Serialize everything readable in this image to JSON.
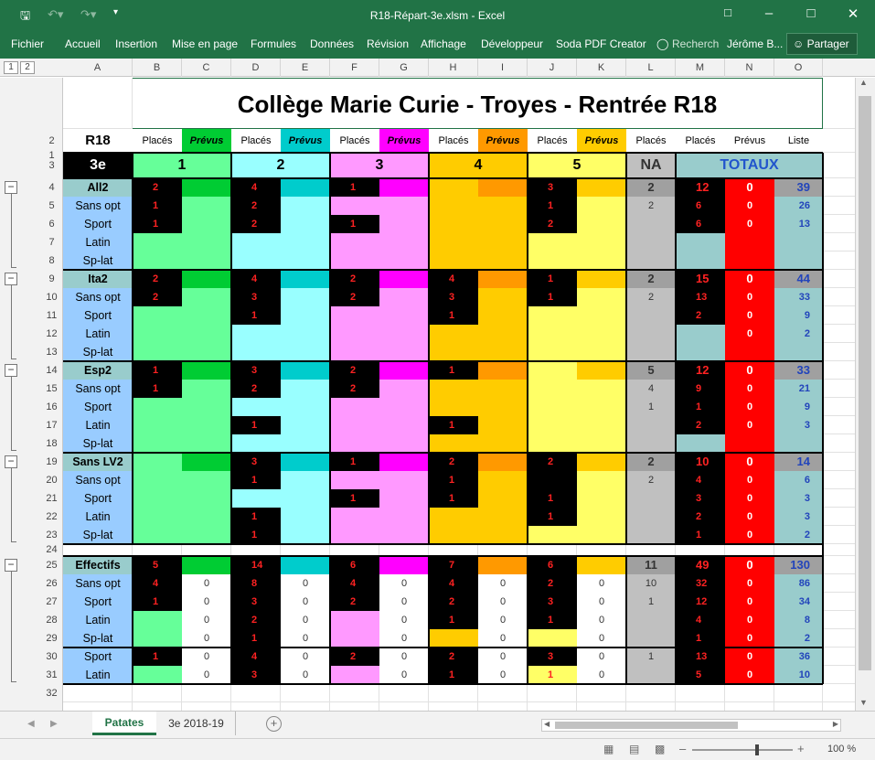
{
  "window": {
    "title": "R18-Répart-3e.xlsm - Excel"
  },
  "ribbon": {
    "tabs": [
      "Fichier",
      "Accueil",
      "Insertion",
      "Mise en page",
      "Formules",
      "Données",
      "Révision",
      "Affichage",
      "Développeur",
      "Soda PDF Creator"
    ],
    "search": "Recherch",
    "user": "Jérôme B...",
    "share": "Partager"
  },
  "outline_levels": [
    "1",
    "2"
  ],
  "columns": [
    "A",
    "B",
    "C",
    "D",
    "E",
    "F",
    "G",
    "H",
    "I",
    "J",
    "K",
    "L",
    "M",
    "N",
    "O"
  ],
  "row_numbers": [
    "1",
    "2",
    "3",
    "4",
    "5",
    "6",
    "7",
    "8",
    "9",
    "10",
    "11",
    "12",
    "13",
    "14",
    "15",
    "16",
    "17",
    "18",
    "19",
    "20",
    "21",
    "22",
    "23",
    "24",
    "25",
    "26",
    "27",
    "28",
    "29",
    "30",
    "31",
    "32"
  ],
  "sheet": {
    "title": "Collège Marie Curie - Troyes - Rentrée R18",
    "header_r18": "R18",
    "header_3e": "3e",
    "row2": [
      "Placés",
      "Prévus",
      "Placés",
      "Prévus",
      "Placés",
      "Prévus",
      "Placés",
      "Prévus",
      "Placés",
      "Prévus",
      "Placés",
      "Placés",
      "Prévus",
      "Liste"
    ],
    "classes": [
      "1",
      "2",
      "3",
      "4",
      "5"
    ],
    "na": "NA",
    "totaux": "TOTAUX",
    "labels": {
      "r4": "All2",
      "r9": "Ita2",
      "r14": "Esp2",
      "r19": "Sans LV2",
      "r25": "Effectifs",
      "r5": "Sans opt",
      "r6": "Sport",
      "r7": "Latin",
      "r8": "Sp-lat",
      "r10": "Sans opt",
      "r11": "Sport",
      "r12": "Latin",
      "r13": "Sp-lat",
      "r15": "Sans opt",
      "r16": "Sport",
      "r17": "Latin",
      "r18": "Sp-lat",
      "r20": "Sans opt",
      "r21": "Sport",
      "r22": "Latin",
      "r23": "Sp-lat",
      "r26": "Sans opt",
      "r27": "Sport",
      "r28": "Latin",
      "r29": "Sp-lat",
      "r30": "Sport",
      "r31": "Latin"
    },
    "values": {
      "r4": {
        "B": "2",
        "D": "4",
        "F": "1",
        "J": "3",
        "L": "2",
        "M": "12",
        "N": "0",
        "O": "39"
      },
      "r5": {
        "B": "1",
        "D": "2",
        "J": "1",
        "L": "2",
        "M": "6",
        "N": "0",
        "O": "26"
      },
      "r6": {
        "B": "1",
        "D": "2",
        "F": "1",
        "J": "2",
        "M": "6",
        "N": "0",
        "O": "13"
      },
      "r9": {
        "B": "2",
        "D": "4",
        "F": "2",
        "H": "4",
        "J": "1",
        "L": "2",
        "M": "15",
        "N": "0",
        "O": "44"
      },
      "r10": {
        "B": "2",
        "D": "3",
        "F": "2",
        "H": "3",
        "J": "1",
        "L": "2",
        "M": "13",
        "N": "0",
        "O": "33"
      },
      "r11": {
        "D": "1",
        "H": "1",
        "M": "2",
        "N": "0",
        "O": "9"
      },
      "r12": {
        "N": "0",
        "O": "2"
      },
      "r14": {
        "B": "1",
        "D": "3",
        "F": "2",
        "H": "1",
        "L": "5",
        "M": "12",
        "N": "0",
        "O": "33"
      },
      "r15": {
        "B": "1",
        "D": "2",
        "F": "2",
        "L": "4",
        "M": "9",
        "N": "0",
        "O": "21"
      },
      "r16": {
        "L": "1",
        "M": "1",
        "N": "0",
        "O": "9"
      },
      "r17": {
        "D": "1",
        "H": "1",
        "M": "2",
        "N": "0",
        "O": "3"
      },
      "r19": {
        "D": "3",
        "F": "1",
        "H": "2",
        "J": "2",
        "L": "2",
        "M": "10",
        "N": "0",
        "O": "14"
      },
      "r20": {
        "D": "1",
        "H": "1",
        "L": "2",
        "M": "4",
        "N": "0",
        "O": "6"
      },
      "r21": {
        "F": "1",
        "H": "1",
        "J": "1",
        "M": "3",
        "N": "0",
        "O": "3"
      },
      "r22": {
        "D": "1",
        "J": "1",
        "M": "2",
        "N": "0",
        "O": "3"
      },
      "r23": {
        "D": "1",
        "M": "1",
        "N": "0",
        "O": "2"
      },
      "r25": {
        "B": "5",
        "D": "14",
        "F": "6",
        "H": "7",
        "J": "6",
        "L": "11",
        "M": "49",
        "N": "0",
        "O": "130"
      },
      "r26": {
        "B": "4",
        "C": "0",
        "D": "8",
        "E": "0",
        "F": "4",
        "G": "0",
        "H": "4",
        "I": "0",
        "J": "2",
        "K": "0",
        "L": "10",
        "M": "32",
        "N": "0",
        "O": "86"
      },
      "r27": {
        "B": "1",
        "C": "0",
        "D": "3",
        "E": "0",
        "F": "2",
        "G": "0",
        "H": "2",
        "I": "0",
        "J": "3",
        "K": "0",
        "L": "1",
        "M": "12",
        "N": "0",
        "O": "34"
      },
      "r28": {
        "C": "0",
        "D": "2",
        "E": "0",
        "G": "0",
        "H": "1",
        "I": "0",
        "J": "1",
        "K": "0",
        "M": "4",
        "N": "0",
        "O": "8"
      },
      "r29": {
        "C": "0",
        "D": "1",
        "E": "0",
        "G": "0",
        "I": "0",
        "K": "0",
        "M": "1",
        "N": "0",
        "O": "2"
      },
      "r30": {
        "B": "1",
        "C": "0",
        "D": "4",
        "E": "0",
        "F": "2",
        "G": "0",
        "H": "2",
        "I": "0",
        "J": "3",
        "K": "0",
        "L": "1",
        "M": "13",
        "N": "0",
        "O": "36"
      },
      "r31": {
        "C": "0",
        "D": "3",
        "E": "0",
        "G": "0",
        "H": "1",
        "I": "0",
        "J": "1",
        "K": "0",
        "M": "5",
        "N": "0",
        "O": "10"
      }
    }
  },
  "tabs": [
    "Patates",
    "3e 2018-19"
  ],
  "status": {
    "zoom": "100 %"
  },
  "colors": {
    "green": "#66ff99",
    "green_dark": "#00cc33",
    "cyan": "#99ffff",
    "cyan_dark": "#00cccc",
    "pink": "#ff99ff",
    "pink_dark": "#ff00ff",
    "orange": "#ffcc00",
    "orange_dark": "#ff9900",
    "yellow": "#ffff66",
    "yellow_dark": "#ffcc00",
    "na_gray": "#c0c0c0",
    "na_dark": "#a0a0a0",
    "totals": "#99cccc",
    "red": "#ff0000",
    "blue_label": "#99ccff",
    "excel_green": "#217346"
  }
}
